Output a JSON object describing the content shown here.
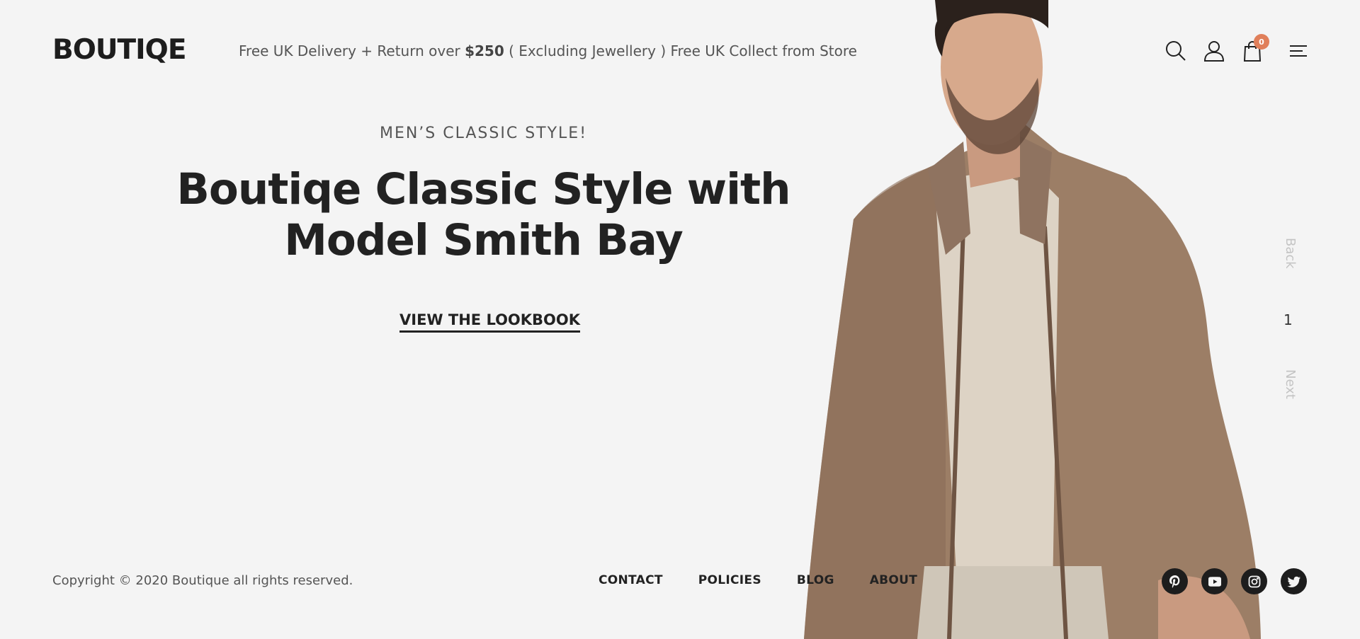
{
  "brand": {
    "logo": "BOUTIQE"
  },
  "promo": {
    "text_before": "Free UK Delivery + Return over ",
    "amount": "$250",
    "text_after": " ( Excluding Jewellery ) Free UK Collect from Store"
  },
  "header_icons": {
    "search": "search-icon",
    "account": "user-icon",
    "cart": "shopping-bag-icon",
    "cart_count": "0",
    "menu": "hamburger-menu-icon"
  },
  "hero": {
    "eyebrow": "MEN’S CLASSIC STYLE!",
    "headline_line1": "Boutiqe Classic Style with",
    "headline_line2": "Model Smith Bay",
    "cta": "VIEW THE LOOKBOOK"
  },
  "slider": {
    "back": "Back",
    "current": "1",
    "next": "Next"
  },
  "footer": {
    "copyright": "Copyright © 2020 Boutique all rights reserved.",
    "links": [
      "CONTACT",
      "POLICIES",
      "BLOG",
      "ABOUT"
    ],
    "social": [
      "pinterest-icon",
      "youtube-icon",
      "instagram-icon",
      "twitter-icon"
    ]
  },
  "colors": {
    "background": "#f4f4f4",
    "text": "#222222",
    "badge": "#e07f5a",
    "jacket": "#9c7e66"
  }
}
